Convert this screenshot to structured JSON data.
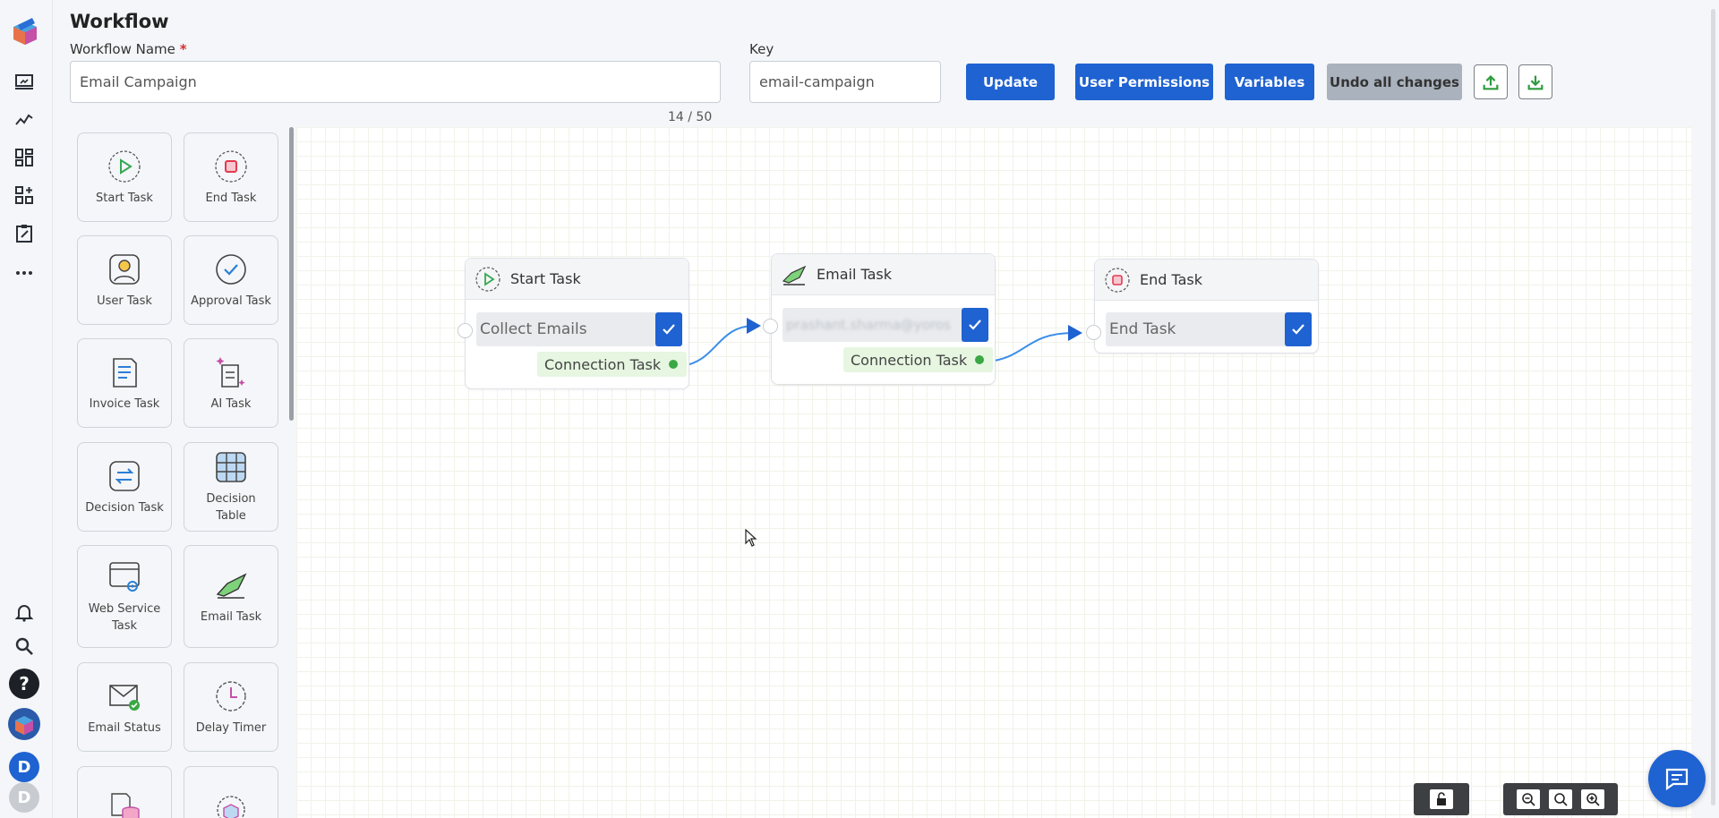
{
  "header": {
    "title": "Workflow",
    "workflow_name_label": "Workflow Name",
    "required_mark": "*",
    "workflow_name_value": "Email Campaign",
    "name_counter": "14 / 50",
    "key_label": "Key",
    "key_value": "email-campaign",
    "buttons": {
      "update": "Update",
      "user_permissions": "User Permissions",
      "variables": "Variables",
      "undo": "Undo all changes"
    },
    "icons": [
      "upload-icon",
      "download-icon"
    ]
  },
  "rail": {
    "icons": [
      "app-logo-icon",
      "monitor-icon",
      "analytics-icon",
      "dashboard-grid-icon",
      "apps-add-icon",
      "clipboard-edit-icon",
      "more-icon",
      "bell-icon",
      "search-icon",
      "help-icon",
      "workspace-logo-icon"
    ],
    "avatars": [
      "D",
      "D"
    ],
    "avatar_colors": [
      "#1f62d1",
      "#c8ccd1"
    ]
  },
  "palette": {
    "tiles": [
      {
        "label": "Start Task",
        "icon": "start-task-icon"
      },
      {
        "label": "End Task",
        "icon": "end-task-icon"
      },
      {
        "label": "User Task",
        "icon": "user-task-icon"
      },
      {
        "label": "Approval Task",
        "icon": "approval-task-icon"
      },
      {
        "label": "Invoice Task",
        "icon": "invoice-task-icon"
      },
      {
        "label": "AI Task",
        "icon": "ai-task-icon"
      },
      {
        "label": "Decision Task",
        "icon": "decision-task-icon"
      },
      {
        "label": "Decision Table",
        "icon": "decision-table-icon"
      },
      {
        "label": "Web Service Task",
        "icon": "web-service-task-icon"
      },
      {
        "label": "Email Task",
        "icon": "email-task-icon"
      },
      {
        "label": "Email Status",
        "icon": "email-status-icon"
      },
      {
        "label": "Delay Timer",
        "icon": "delay-timer-icon"
      },
      {
        "label": "",
        "icon": "database-task-icon"
      },
      {
        "label": "",
        "icon": "package-task-icon"
      }
    ]
  },
  "canvas": {
    "nodes": [
      {
        "title": "Start Task",
        "field": "Collect Emails",
        "connection": "Connection Task"
      },
      {
        "title": "Email Task",
        "field": "prashant.sharma@yoros",
        "connection": "Connection Task"
      },
      {
        "title": "End Task",
        "field": "End Task",
        "connection": ""
      }
    ]
  },
  "controls": {
    "icons": [
      "lock-open-icon",
      "zoom-out-icon",
      "zoom-reset-icon",
      "zoom-in-icon",
      "chat-icon"
    ]
  },
  "colors": {
    "primary": "#1f62d1",
    "disabled": "#a9b2bd",
    "connection_bg": "#e6f6e1",
    "connection_dot": "#3aa845",
    "start_green": "#34a853",
    "end_red": "#e53950"
  }
}
